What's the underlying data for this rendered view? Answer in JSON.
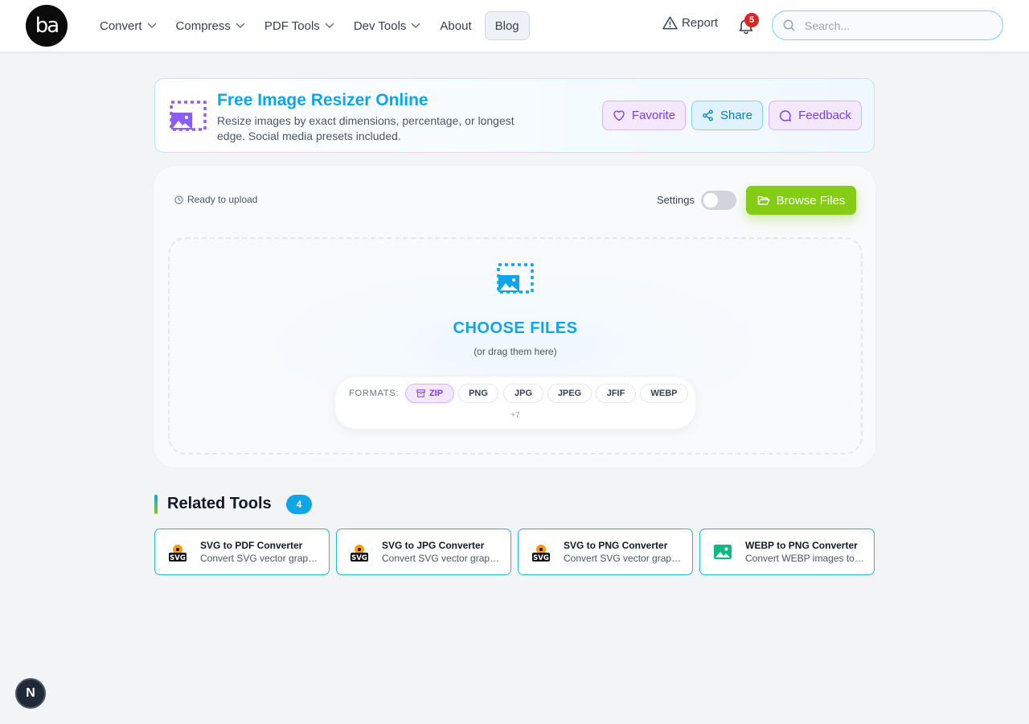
{
  "header": {
    "logo_text": "ba",
    "nav": [
      {
        "label": "Convert",
        "dropdown": true
      },
      {
        "label": "Compress",
        "dropdown": true
      },
      {
        "label": "PDF Tools",
        "dropdown": true
      },
      {
        "label": "Dev Tools",
        "dropdown": true
      },
      {
        "label": "About",
        "dropdown": false
      },
      {
        "label": "Blog",
        "dropdown": false,
        "active": true
      }
    ],
    "report_label": "Report",
    "notification_count": "5",
    "search_placeholder": "Search..."
  },
  "tool": {
    "title": "Free Image Resizer Online",
    "description": "Resize images by exact dimensions, percentage, or longest edge. Social media presets included.",
    "buttons": {
      "favorite": "Favorite",
      "share": "Share",
      "feedback": "Feedback"
    }
  },
  "upload": {
    "status": "Ready to upload",
    "settings_label": "Settings",
    "settings_enabled": false,
    "browse_label": "Browse Files",
    "choose_label": "CHOOSE FILES",
    "drag_hint": "(or drag them here)",
    "formats_label": "FORMATS:",
    "formats": [
      "ZIP",
      "PNG",
      "JPG",
      "JPEG",
      "JFIF",
      "WEBP"
    ],
    "more_formats": "+7"
  },
  "related": {
    "title": "Related Tools",
    "count": "4",
    "tools": [
      {
        "name": "SVG to PDF Converter",
        "desc": "Convert SVG vector graphics to PDF",
        "icon": "svg-icon"
      },
      {
        "name": "SVG to JPG Converter",
        "desc": "Convert SVG vector graphics to JPG",
        "icon": "svg-icon"
      },
      {
        "name": "SVG to PNG Converter",
        "desc": "Convert SVG vector graphics to PNG",
        "icon": "svg-icon"
      },
      {
        "name": "WEBP to PNG Converter",
        "desc": "Convert WEBP images to PNG",
        "icon": "image-icon"
      }
    ]
  },
  "dev_badge": "N",
  "colors": {
    "accent": "#0ea5e9",
    "purple": "#7c3aed",
    "green": "#84cc16",
    "badge_red": "#dc2626"
  }
}
